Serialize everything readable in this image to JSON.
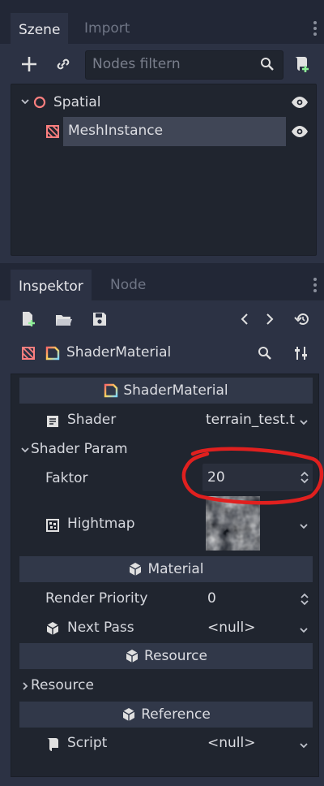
{
  "scene_dock": {
    "tabs": [
      {
        "label": "Szene",
        "active": true
      },
      {
        "label": "Import",
        "active": false
      }
    ],
    "filter_placeholder": "Nodes filtern",
    "nodes": [
      {
        "name": "Spatial",
        "icon": "spatial-node-icon",
        "visible": true,
        "expanded": true
      },
      {
        "name": "MeshInstance",
        "icon": "mesh-instance-icon",
        "visible": true,
        "selected": true
      }
    ]
  },
  "inspector_dock": {
    "tabs": [
      {
        "label": "Inspektor",
        "active": true
      },
      {
        "label": "Node",
        "active": false
      }
    ],
    "object_title": "ShaderMaterial",
    "sections": {
      "shader_material": "ShaderMaterial",
      "material": "Material",
      "resource": "Resource",
      "reference": "Reference"
    },
    "properties": {
      "shader": {
        "label": "Shader",
        "value": "terrain_test.t"
      },
      "shader_param_group": "Shader Param",
      "faktor": {
        "label": "Faktor",
        "value": "20"
      },
      "hightmap": {
        "label": "Hightmap",
        "value": "noise-texture"
      },
      "render_priority": {
        "label": "Render Priority",
        "value": "0"
      },
      "next_pass": {
        "label": "Next Pass",
        "value": "<null>"
      },
      "resource_group": "Resource",
      "script": {
        "label": "Script",
        "value": "<null>"
      }
    }
  },
  "colors": {
    "background": "#222736",
    "panel": "#2c3244",
    "tree_background": "#20252f",
    "selected_row": "#404656",
    "section_header": "#313849",
    "node_icon_red": "#fc7f7f",
    "annotation_red": "#e0201f",
    "add_button_green": "#8eef97"
  }
}
